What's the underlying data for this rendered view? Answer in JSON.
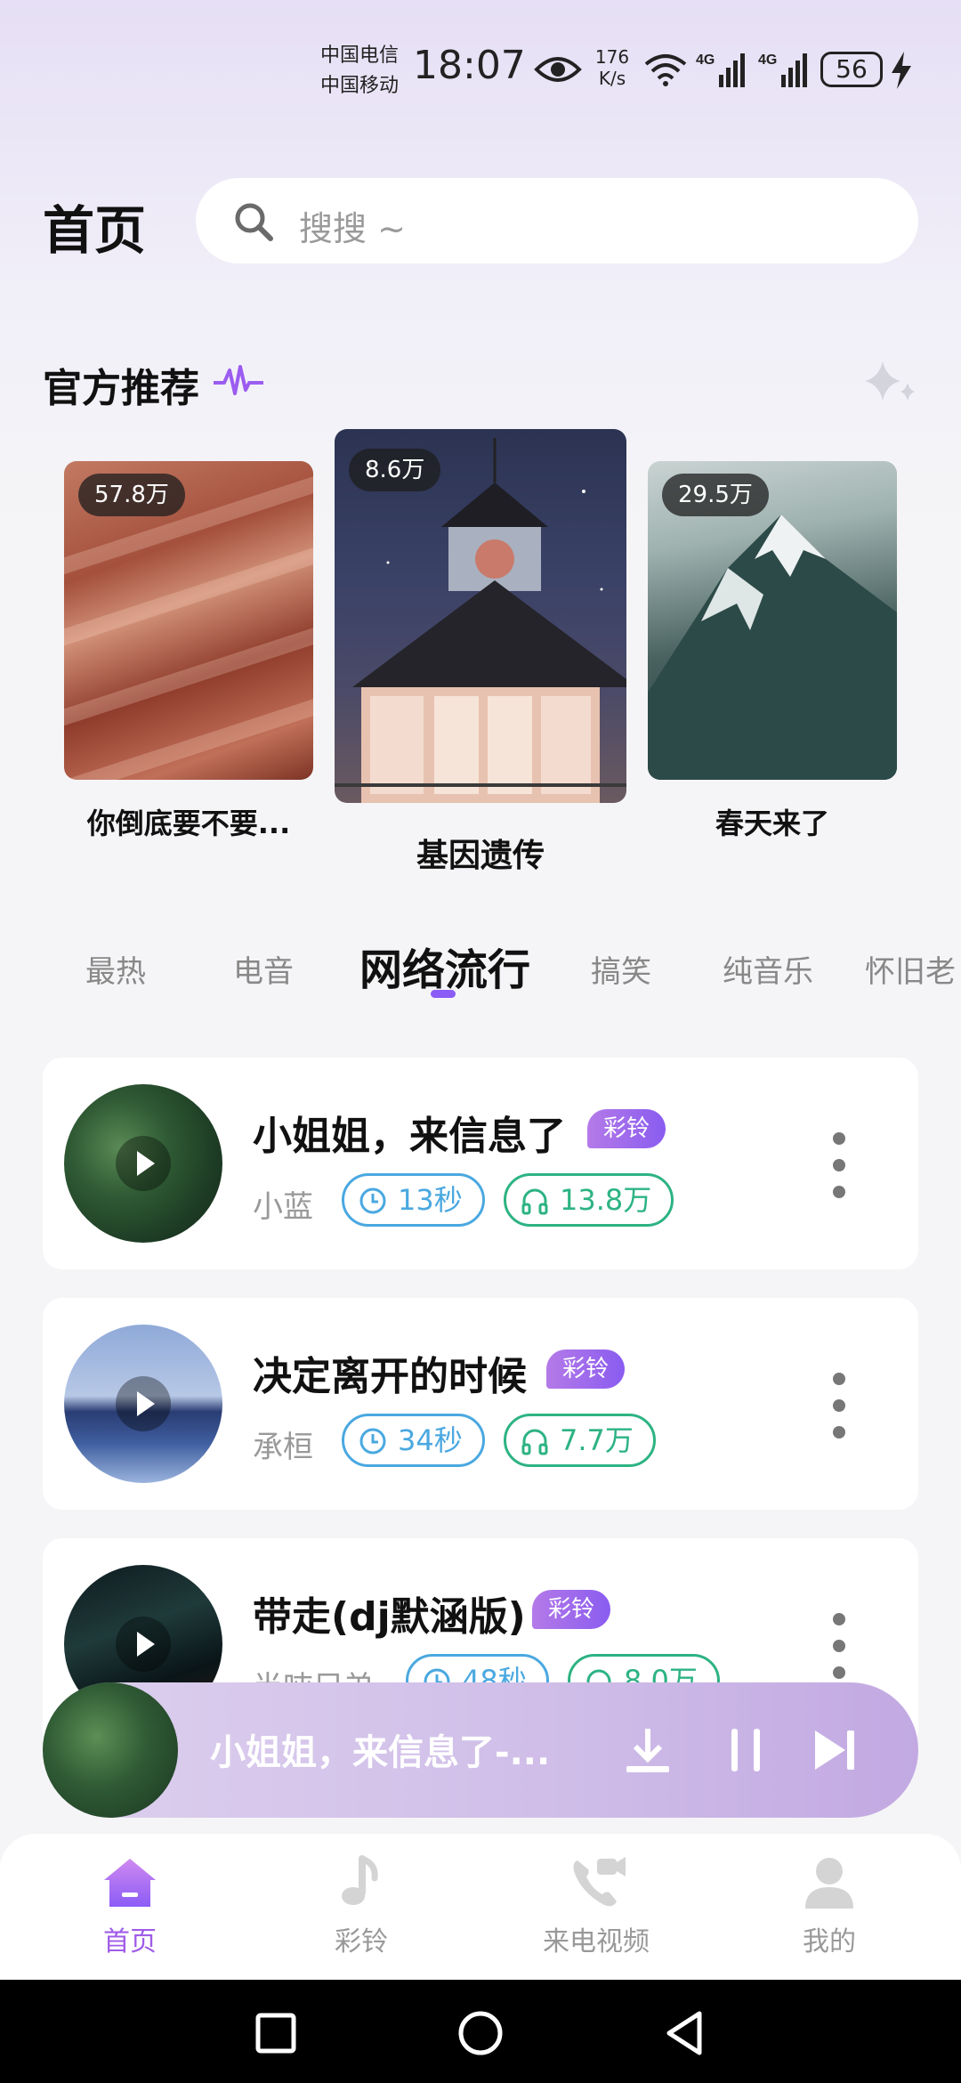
{
  "status_bar": {
    "carrier_1": "中国电信",
    "carrier_2": "中国移动",
    "time": "18:07",
    "speed_value": "176",
    "speed_unit": "K/s",
    "signal_1": "4G",
    "signal_2": "4G",
    "battery": "56"
  },
  "header": {
    "title": "首页",
    "search_placeholder": "搜搜 ~"
  },
  "recommend": {
    "title": "官方推荐",
    "items": [
      {
        "count": "57.8万",
        "name": "你倒底要不要..."
      },
      {
        "count": "8.6万",
        "name": "基因遗传"
      },
      {
        "count": "29.5万",
        "name": "春天来了"
      }
    ]
  },
  "tabs": [
    "最热",
    "电音",
    "网络流行",
    "搞笑",
    "纯音乐",
    "怀旧老"
  ],
  "active_tab": "网络流行",
  "songs": [
    {
      "title": "小姐姐，来信息了",
      "badge": "彩铃",
      "artist": "小蓝",
      "duration": "13秒",
      "plays": "13.8万"
    },
    {
      "title": "决定离开的时候",
      "badge": "彩铃",
      "artist": "承桓",
      "duration": "34秒",
      "plays": "7.7万"
    },
    {
      "title": "带走(dj默涵版)",
      "badge": "彩铃",
      "artist": "半吨兄弟",
      "duration": "48秒",
      "plays": "8.0万"
    }
  ],
  "player": {
    "title": "小姐姐，来信息了-..."
  },
  "bottom_nav": [
    {
      "label": "首页",
      "icon": "home-icon",
      "active": true
    },
    {
      "label": "彩铃",
      "icon": "music-note-icon",
      "active": false
    },
    {
      "label": "来电视频",
      "icon": "video-call-icon",
      "active": false
    },
    {
      "label": "我的",
      "icon": "profile-icon",
      "active": false
    }
  ],
  "colors": {
    "accent": "#8b5cf6",
    "badge": "#a46cec",
    "duration": "#4aa8e0",
    "plays": "#2db383"
  }
}
